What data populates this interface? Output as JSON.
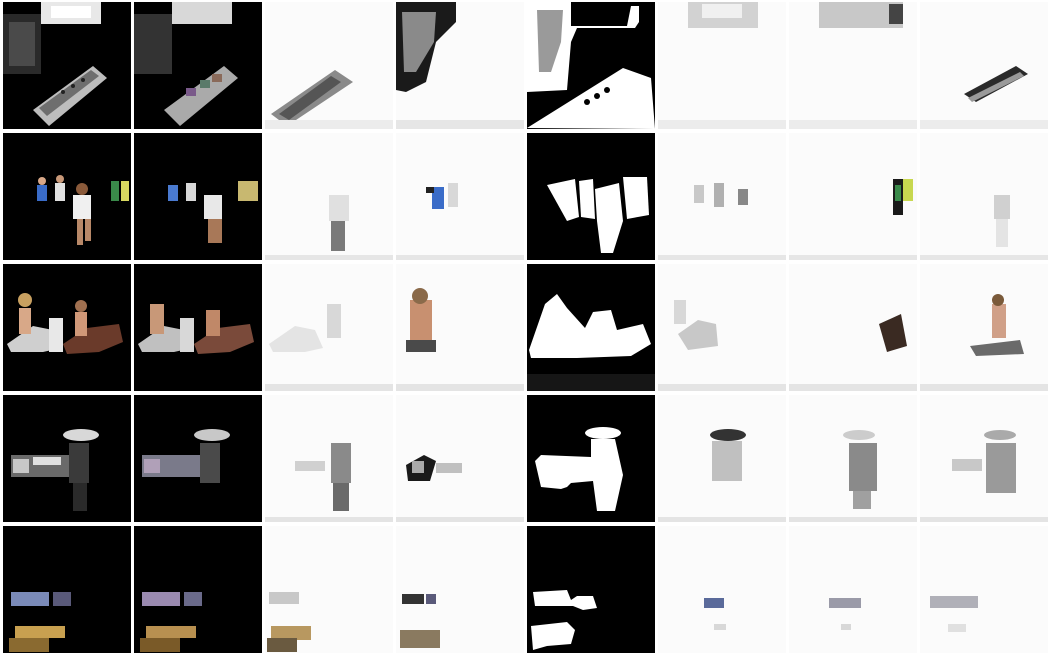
{
  "figure": {
    "rows": [
      {
        "name": "remote-control",
        "cells": [
          "color-crop",
          "color-crop-blocky",
          "layer-white",
          "layer-white",
          "mask-bw",
          "layer-white",
          "layer-white",
          "layer-white"
        ]
      },
      {
        "name": "runners",
        "cells": [
          "color-crop",
          "color-crop-blocky",
          "layer-white",
          "layer-white",
          "mask-bw",
          "layer-white",
          "layer-white",
          "layer-white"
        ]
      },
      {
        "name": "horse-riders",
        "cells": [
          "color-crop",
          "color-crop-blocky",
          "layer-white",
          "layer-white",
          "mask-bw",
          "layer-white",
          "layer-white",
          "layer-white"
        ]
      },
      {
        "name": "umbrella-car",
        "cells": [
          "color-crop",
          "color-crop-blocky",
          "layer-white",
          "layer-white",
          "mask-bw",
          "layer-white",
          "layer-white",
          "layer-white"
        ]
      },
      {
        "name": "table-objects",
        "cells": [
          "color-crop",
          "color-crop-blocky",
          "layer-white",
          "layer-white",
          "mask-bw",
          "layer-white",
          "layer-white",
          "layer-white"
        ]
      }
    ],
    "colors": {
      "background": "#000000",
      "layer_bg": "#fbfbfb",
      "mask_fg": "#ffffff"
    }
  }
}
